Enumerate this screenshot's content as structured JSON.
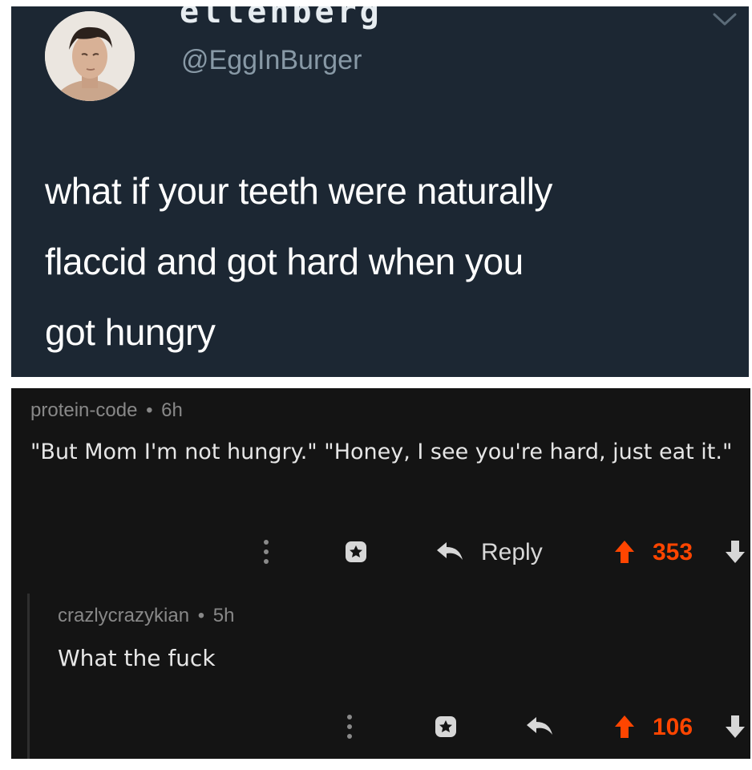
{
  "tweet": {
    "display_name": "ellenberg",
    "handle": "@EggInBurger",
    "lines": [
      "what if your teeth were naturally",
      "flaccid and got hard when you",
      "got hungry"
    ]
  },
  "comments": [
    {
      "author": "protein-code",
      "separator": "•",
      "age": "6h",
      "body": "\"But Mom I'm not hungry.\" \"Honey, I see you're hard, just eat it.\"",
      "reply_label": "Reply",
      "score": "353"
    },
    {
      "author": "crazlycrazykian",
      "separator": "•",
      "age": "5h",
      "body": "What the fuck",
      "score": "106"
    }
  ],
  "icons": {
    "more": "more-vertical-icon",
    "award": "award-icon",
    "reply": "reply-arrow-icon",
    "upvote": "upvote-arrow-icon",
    "downvote": "downvote-arrow-icon",
    "caret": "chevron-down-icon"
  },
  "colors": {
    "tweet_bg": "#1c2733",
    "reddit_bg": "#141414",
    "upvote_accent": "#ff4500",
    "meta_gray": "#888888"
  }
}
